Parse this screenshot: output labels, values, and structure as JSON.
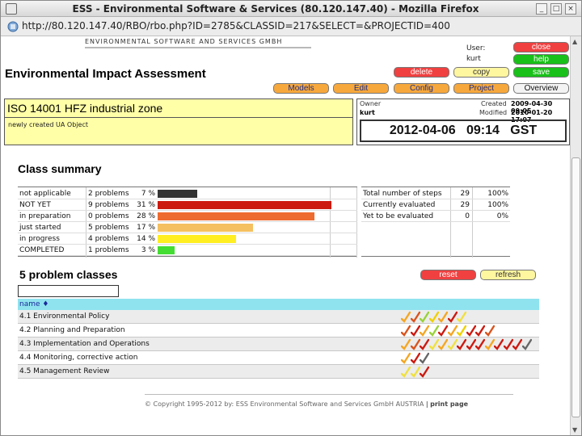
{
  "browser": {
    "window_title": "ESS - Environmental Software & Services (80.120.147.40) - Mozilla Firefox",
    "url": "http://80.120.147.40/RBO/rbo.php?ID=2785&CLASSID=217&SELECT=&PROJECTID=400"
  },
  "header": {
    "brand": "Environmental Software and Services GmbH",
    "app_title": "Environmental Impact Assessment",
    "user_label": "User:",
    "user_name": "kurt"
  },
  "buttons": {
    "close": "close",
    "help": "help",
    "delete": "delete",
    "copy": "copy",
    "save": "save",
    "models": "Models",
    "edit": "Edit",
    "config": "Config",
    "project": "Project",
    "overview": "Overview",
    "reset": "reset",
    "refresh": "refresh"
  },
  "project": {
    "name": "ISO 14001 HFZ industrial zone",
    "description": "newly created UA Object",
    "owner_label": "Owner",
    "owner": "kurt",
    "created_label": "Created",
    "created": "2009-04-30 09:05",
    "modified_label": "Modified",
    "modified": "2010-01-20 17:07",
    "clock": "2012-04-06   09:14   GST"
  },
  "summary": {
    "title": "Class summary",
    "rows": [
      {
        "label": "not applicable",
        "problems": "2 problems",
        "pct": "7 %",
        "value": 7,
        "color": "#333333"
      },
      {
        "label": "NOT YET",
        "problems": "9 problems",
        "pct": "31 %",
        "value": 31,
        "color": "#cc1a10"
      },
      {
        "label": "in preparation",
        "problems": "0 problems",
        "pct": "28 %",
        "value": 28,
        "color": "#ee6b2f"
      },
      {
        "label": "just started",
        "problems": "5 problems",
        "pct": "17 %",
        "value": 17,
        "color": "#f5c060"
      },
      {
        "label": "in progress",
        "problems": "4 problems",
        "pct": "14 %",
        "value": 14,
        "color": "#ffee22"
      },
      {
        "label": "COMPLETED",
        "problems": "1 problems",
        "pct": "3 %",
        "value": 3,
        "color": "#44dd33"
      }
    ],
    "steps": [
      {
        "label": "Total number of steps",
        "count": "29",
        "pct": "100%"
      },
      {
        "label": "Currently evaluated",
        "count": "29",
        "pct": "100%"
      },
      {
        "label": "Yet to be evaluated",
        "count": "0",
        "pct": "0%"
      }
    ]
  },
  "classes": {
    "title": "5 problem classes",
    "column_name": "name ♦",
    "rows": [
      {
        "name": "4.1 Environmental Policy",
        "ticks": [
          "#f5a623",
          "#d9541e",
          "#9ad13a",
          "#f0d000",
          "#f5a623",
          "#cc1a10",
          "#f0e040"
        ]
      },
      {
        "name": "4.2 Planning and Preparation",
        "ticks": [
          "#d9541e",
          "#cc1a10",
          "#f5a623",
          "#9ad13a",
          "#cc1a10",
          "#f5a623",
          "#f0d000",
          "#cc1a10",
          "#cc1a10",
          "#d9541e"
        ]
      },
      {
        "name": "4.3 Implementation and Operations",
        "ticks": [
          "#f5a623",
          "#d9541e",
          "#cc1a10",
          "#f0e040",
          "#f5a623",
          "#f0e040",
          "#cc1a10",
          "#cc1a10",
          "#cc1a10",
          "#f5a623",
          "#cc1a10",
          "#cc1a10",
          "#cc1a10",
          "#666666"
        ]
      },
      {
        "name": "4.4 Monitoring, corrective action",
        "ticks": [
          "#f5a623",
          "#cc1a10",
          "#666666"
        ]
      },
      {
        "name": "4.5 Management Review",
        "ticks": [
          "#f0e040",
          "#f0e040",
          "#cc1a10"
        ]
      }
    ]
  },
  "footer": {
    "copyright": "© Copyright 1995-2012 by:   ESS   Environmental Software and Services GmbH AUSTRIA",
    "print": "print page"
  }
}
